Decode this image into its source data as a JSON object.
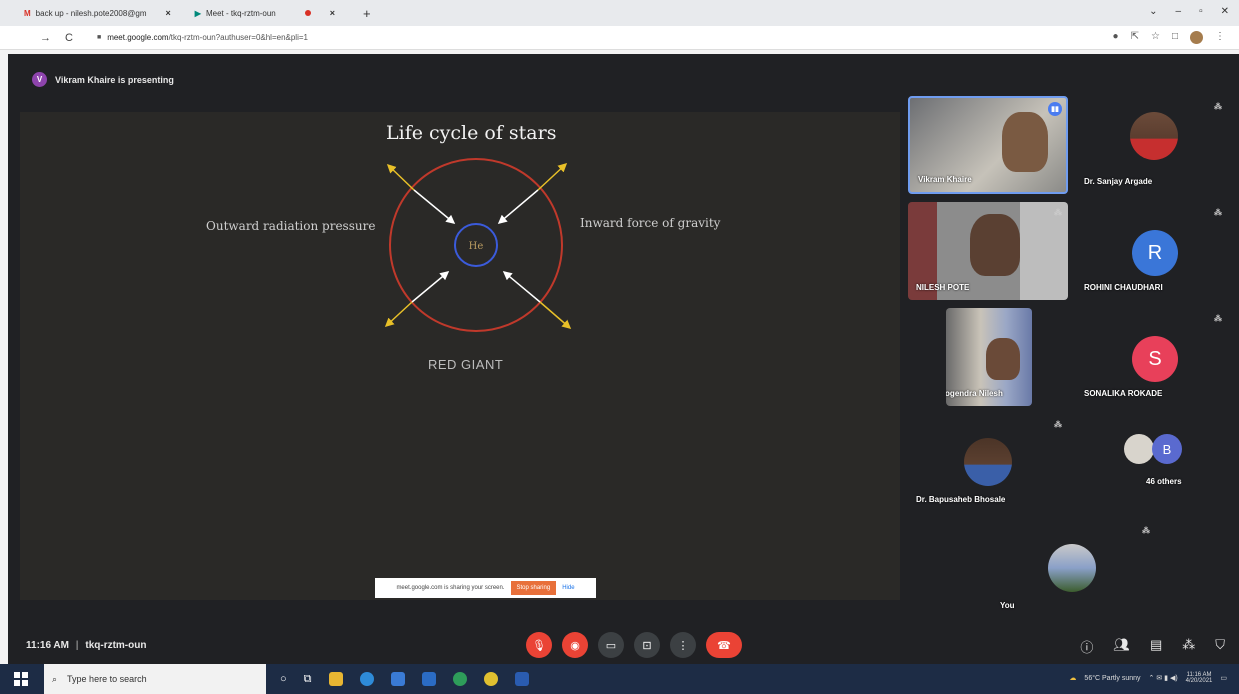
{
  "browser": {
    "tabs": [
      {
        "label": "back up - nilesh.pote2008@gm"
      },
      {
        "label": "Meet - tkq-rztm-oun"
      }
    ],
    "url_host": "meet.google.com",
    "url_path": "/tkq-rztm-oun?authuser=0&hl=en&pli=1"
  },
  "meet": {
    "presenter_initial": "V",
    "presenting_text": "Vikram Khaire is presenting",
    "meeting_time": "11:16 AM",
    "meeting_code": "tkq-rztm-oun"
  },
  "slide": {
    "title": "Life cycle of stars",
    "label_left": "Outward radiation pressure",
    "label_right": "Inward force of gravity",
    "core_label": "He",
    "bottom_label": "RED GIANT"
  },
  "share_bar": {
    "message": "meet.google.com is sharing your screen.",
    "stop_label": "Stop sharing",
    "hide_label": "Hide"
  },
  "participants": [
    {
      "name": "Vikram Khaire",
      "initial": "",
      "color": ""
    },
    {
      "name": "Dr. Sanjay Argade",
      "initial": "",
      "color": ""
    },
    {
      "name": "NILESH POTE",
      "initial": "",
      "color": ""
    },
    {
      "name": "ROHINI CHAUDHARI",
      "initial": "R",
      "color": "#3a76d8"
    },
    {
      "name": "Mule Yogendra Nilesh",
      "initial": "",
      "color": ""
    },
    {
      "name": "SONALIKA ROKADE",
      "initial": "S",
      "color": "#e8405a"
    },
    {
      "name": "Dr. Bapusaheb Bhosale",
      "initial": "",
      "color": ""
    },
    {
      "name": "46 others",
      "initial": "B",
      "color": "#5a6acf"
    },
    {
      "name": "You",
      "initial": "",
      "color": ""
    }
  ],
  "taskbar": {
    "search_placeholder": "Type here to search",
    "weather": "56°C Partly sunny",
    "clock_time": "11:16 AM",
    "clock_date": "4/20/2021"
  },
  "colors": {
    "meet_bg": "#202124",
    "end_call": "#ea4335",
    "ring_red": "#c0392b",
    "core_blue": "#3b5bdb",
    "arrow_yellow": "#e8c028"
  }
}
